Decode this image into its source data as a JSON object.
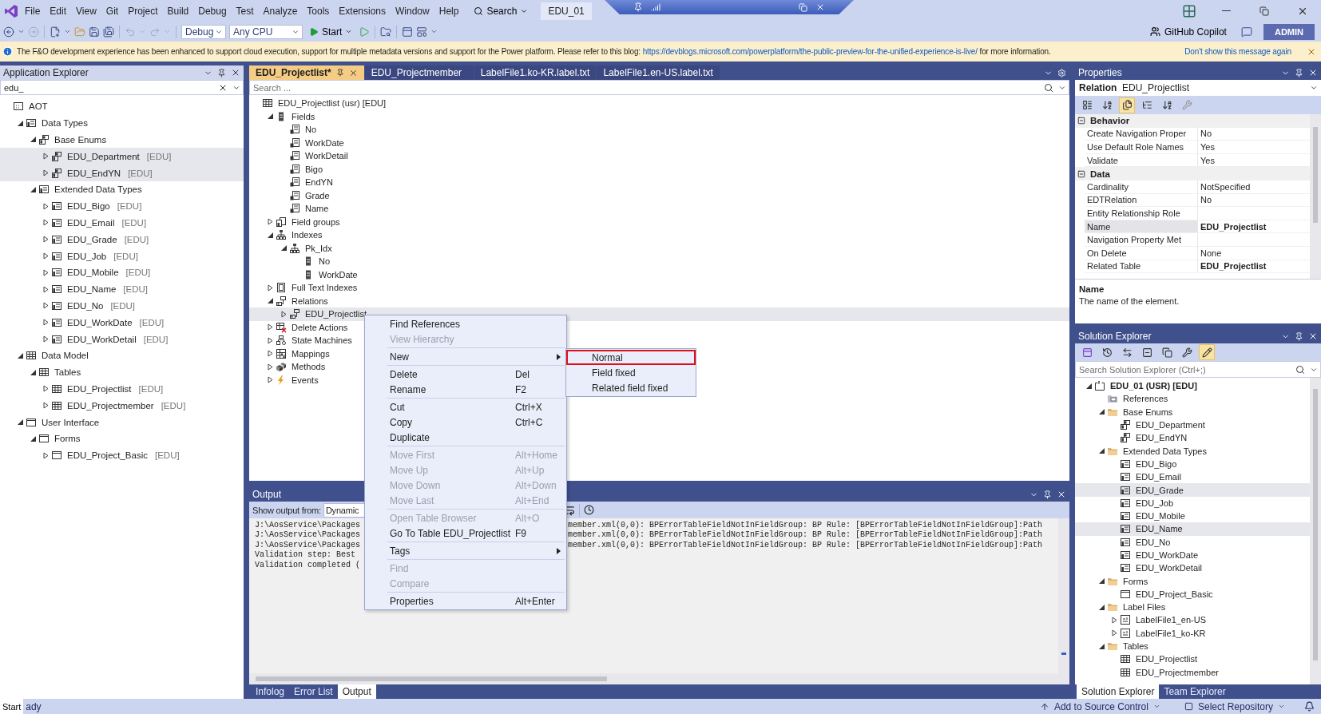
{
  "menu_bar": {
    "items": [
      "File",
      "Edit",
      "View",
      "Git",
      "Project",
      "Build",
      "Debug",
      "Test",
      "Analyze",
      "Tools",
      "Extensions",
      "Window",
      "Help"
    ],
    "search": "Search",
    "solution_name": "EDU_01"
  },
  "toolbar": {
    "configuration": "Debug",
    "platform": "Any CPU",
    "start": "Start",
    "copilot": "GitHub Copilot",
    "account": "ADMIN"
  },
  "info_bar": {
    "text": "The F&O development experience has been enhanced to support cloud execution, support for multiple metadata versions and support for the Power platform. Please refer to this blog:",
    "link": "https://devblogs.microsoft.com/powerplatform/the-public-preview-for-the-unified-experience-is-live/",
    "text_after": "for more information.",
    "dismiss": "Don't show this message again"
  },
  "application_explorer": {
    "title": "Application Explorer",
    "search": "edu_",
    "tree": [
      {
        "label": "AOT",
        "kind": "aot",
        "selected": false,
        "children": [
          {
            "label": "Data Types",
            "kind": "datatypes",
            "selected": false,
            "expanded": true,
            "children": [
              {
                "label": "Base Enums",
                "kind": "enum",
                "selected": false,
                "expanded": true,
                "children": [
                  {
                    "label": "EDU_Department",
                    "tag": "[EDU]",
                    "kind": "enum",
                    "selected": true,
                    "expanded": false
                  },
                  {
                    "label": "EDU_EndYN",
                    "tag": "[EDU]",
                    "kind": "enum",
                    "selected": true,
                    "expanded": false
                  }
                ]
              },
              {
                "label": "Extended Data Types",
                "kind": "edt",
                "selected": false,
                "expanded": true,
                "children": [
                  {
                    "label": "EDU_Bigo",
                    "tag": "[EDU]",
                    "kind": "edt",
                    "selected": false,
                    "expanded": false
                  },
                  {
                    "label": "EDU_Email",
                    "tag": "[EDU]",
                    "kind": "edt",
                    "selected": false,
                    "expanded": false
                  },
                  {
                    "label": "EDU_Grade",
                    "tag": "[EDU]",
                    "kind": "edt",
                    "selected": false,
                    "expanded": false
                  },
                  {
                    "label": "EDU_Job",
                    "tag": "[EDU]",
                    "kind": "edt",
                    "selected": false,
                    "expanded": false
                  },
                  {
                    "label": "EDU_Mobile",
                    "tag": "[EDU]",
                    "kind": "edt",
                    "selected": false,
                    "expanded": false
                  },
                  {
                    "label": "EDU_Name",
                    "tag": "[EDU]",
                    "kind": "edt",
                    "selected": false,
                    "expanded": false
                  },
                  {
                    "label": "EDU_No",
                    "tag": "[EDU]",
                    "kind": "edt",
                    "selected": false,
                    "expanded": false
                  },
                  {
                    "label": "EDU_WorkDate",
                    "tag": "[EDU]",
                    "kind": "edt",
                    "selected": false,
                    "expanded": false
                  },
                  {
                    "label": "EDU_WorkDetail",
                    "tag": "[EDU]",
                    "kind": "edt",
                    "selected": false,
                    "expanded": false
                  }
                ]
              }
            ]
          },
          {
            "label": "Data Model",
            "kind": "table",
            "selected": false,
            "expanded": true,
            "children": [
              {
                "label": "Tables",
                "kind": "table",
                "selected": false,
                "expanded": true,
                "children": [
                  {
                    "label": "EDU_Projectlist",
                    "tag": "[EDU]",
                    "kind": "table",
                    "selected": false,
                    "expanded": false
                  },
                  {
                    "label": "EDU_Projectmember",
                    "tag": "[EDU]",
                    "kind": "table",
                    "selected": false,
                    "expanded": false
                  }
                ]
              }
            ]
          },
          {
            "label": "User Interface",
            "kind": "form",
            "selected": false,
            "expanded": true,
            "children": [
              {
                "label": "Forms",
                "kind": "form",
                "selected": false,
                "expanded": true,
                "children": [
                  {
                    "label": "EDU_Project_Basic",
                    "tag": "[EDU]",
                    "kind": "form",
                    "selected": false,
                    "expanded": false
                  }
                ]
              }
            ]
          }
        ]
      }
    ]
  },
  "editor": {
    "tabs": [
      {
        "label": "EDU_Projectlist*",
        "selected": true
      },
      {
        "label": "EDU_Projectmember",
        "selected": false
      },
      {
        "label": "LabelFile1.ko-KR.label.txt",
        "selected": false
      },
      {
        "label": "LabelFile1.en-US.label.txt",
        "selected": false
      }
    ],
    "search_placeholder": "Search ...",
    "tree": [
      {
        "label": "EDU_Projectlist (usr) [EDU]",
        "kind": "table",
        "selected": false,
        "children": [
          {
            "label": "Fields",
            "kind": "column",
            "selected": false,
            "expanded": true,
            "children": [
              {
                "label": "No",
                "kind": "field",
                "selected": false
              },
              {
                "label": "WorkDate",
                "kind": "field",
                "selected": false
              },
              {
                "label": "WorkDetail",
                "kind": "field",
                "selected": false
              },
              {
                "label": "Bigo",
                "kind": "field",
                "selected": false
              },
              {
                "label": "EndYN",
                "kind": "field",
                "selected": false
              },
              {
                "label": "Grade",
                "kind": "field",
                "selected": false
              },
              {
                "label": "Name",
                "kind": "field",
                "selected": false
              }
            ]
          },
          {
            "label": "Field groups",
            "kind": "fieldgroups",
            "selected": false,
            "expanded": false
          },
          {
            "label": "Indexes",
            "kind": "index",
            "selected": false,
            "expanded": true,
            "children": [
              {
                "label": "Pk_Idx",
                "kind": "index",
                "selected": false,
                "expanded": true,
                "children": [
                  {
                    "label": "No",
                    "kind": "column",
                    "selected": false
                  },
                  {
                    "label": "WorkDate",
                    "kind": "column",
                    "selected": false
                  }
                ]
              }
            ]
          },
          {
            "label": "Full Text Indexes",
            "kind": "fulltext",
            "selected": false,
            "expanded": false
          },
          {
            "label": "Relations",
            "kind": "relation",
            "selected": false,
            "expanded": true,
            "children": [
              {
                "label": "EDU_Projectlist",
                "kind": "relation",
                "selected": true,
                "expanded": false
              }
            ]
          },
          {
            "label": "Delete Actions",
            "kind": "delete",
            "selected": false,
            "expanded": false
          },
          {
            "label": "State Machines",
            "kind": "state",
            "selected": false,
            "expanded": false
          },
          {
            "label": "Mappings",
            "kind": "mapping",
            "selected": false,
            "expanded": false
          },
          {
            "label": "Methods",
            "kind": "methods",
            "selected": false,
            "expanded": false
          },
          {
            "label": "Events",
            "kind": "events",
            "selected": false,
            "expanded": false
          }
        ]
      }
    ]
  },
  "context_menu": {
    "groups": [
      [
        {
          "label": "Find References",
          "disabled": false
        },
        {
          "label": "View Hierarchy",
          "disabled": true
        }
      ],
      [
        {
          "label": "New",
          "disabled": false,
          "submenu": true
        }
      ],
      [
        {
          "label": "Delete",
          "shortcut": "Del",
          "disabled": false
        },
        {
          "label": "Rename",
          "shortcut": "F2",
          "disabled": false
        }
      ],
      [
        {
          "label": "Cut",
          "shortcut": "Ctrl+X",
          "disabled": false
        },
        {
          "label": "Copy",
          "shortcut": "Ctrl+C",
          "disabled": false
        },
        {
          "label": "Duplicate",
          "disabled": false
        }
      ],
      [
        {
          "label": "Move First",
          "shortcut": "Alt+Home",
          "disabled": true
        },
        {
          "label": "Move Up",
          "shortcut": "Alt+Up",
          "disabled": true
        },
        {
          "label": "Move Down",
          "shortcut": "Alt+Down",
          "disabled": true
        },
        {
          "label": "Move Last",
          "shortcut": "Alt+End",
          "disabled": true
        }
      ],
      [
        {
          "label": "Open Table Browser",
          "shortcut": "Alt+O",
          "disabled": true
        },
        {
          "label": "Go To Table EDU_Projectlist",
          "shortcut": "F9",
          "disabled": false
        }
      ],
      [
        {
          "label": "Tags",
          "disabled": false,
          "submenu": true
        }
      ],
      [
        {
          "label": "Find",
          "disabled": true
        },
        {
          "label": "Compare",
          "disabled": true
        }
      ],
      [
        {
          "label": "Properties",
          "shortcut": "Alt+Enter",
          "disabled": false
        }
      ]
    ],
    "submenu": [
      {
        "label": "Normal",
        "selected": true
      },
      {
        "label": "Field fixed",
        "selected": false
      },
      {
        "label": "Related field fixed",
        "selected": false
      }
    ]
  },
  "output": {
    "title": "Output",
    "show_from_label": "Show output from:",
    "source": "Dynamic",
    "lines": [
      {
        "left": "J:\\AosService\\Packages",
        "right": "member.xml(0,0):  BPErrorTableFieldNotInFieldGroup: BP Rule: [BPErrorTableFieldNotInFieldGroup]:Path"
      },
      {
        "left": "J:\\AosService\\Packages",
        "right": "member.xml(0,0):  BPErrorTableFieldNotInFieldGroup: BP Rule: [BPErrorTableFieldNotInFieldGroup]:Path"
      },
      {
        "left": "J:\\AosService\\Packages",
        "right": "member.xml(0,0):  BPErrorTableFieldNotInFieldGroup: BP Rule: [BPErrorTableFieldNotInFieldGroup]:Path"
      },
      {
        "left": "Validation step: Best"
      },
      {
        "left": "Validation completed ("
      }
    ],
    "tabs": [
      {
        "label": "Infolog",
        "selected": false
      },
      {
        "label": "Error List",
        "selected": false
      },
      {
        "label": "Output",
        "selected": true
      }
    ]
  },
  "properties": {
    "title": "Properties",
    "object_type": "Relation",
    "object_name": "EDU_Projectlist",
    "categories": [
      {
        "name": "Behavior",
        "expanded": true,
        "rows": [
          {
            "name": "Create Navigation Proper",
            "value": "No",
            "selected": false
          },
          {
            "name": "Use Default Role Names",
            "value": "Yes",
            "selected": false
          },
          {
            "name": "Validate",
            "value": "Yes",
            "selected": false
          }
        ]
      },
      {
        "name": "Data",
        "expanded": true,
        "rows": [
          {
            "name": "Cardinality",
            "value": "NotSpecified",
            "selected": false
          },
          {
            "name": "EDTRelation",
            "value": "No",
            "selected": false
          },
          {
            "name": "Entity Relationship Role",
            "selected": false
          },
          {
            "name": "Name",
            "value": "EDU_Projectlist",
            "bold": true,
            "selected": true
          },
          {
            "name": "Navigation Property Met",
            "selected": false
          },
          {
            "name": "On Delete",
            "value": "None",
            "selected": false
          },
          {
            "name": "Related Table",
            "value": "EDU_Projectlist",
            "bold": true,
            "selected": false
          }
        ]
      }
    ],
    "description_title": "Name",
    "description": "The name of the element."
  },
  "solution_explorer": {
    "title": "Solution Explorer",
    "search_placeholder": "Search Solution Explorer (Ctrl+;)",
    "tree": [
      {
        "label": "EDU_01 (USR) [EDU]",
        "kind": "project",
        "selected": false,
        "expanded": true,
        "children": [
          {
            "label": "References",
            "kind": "references",
            "selected": false
          },
          {
            "label": "Base Enums",
            "kind": "folder",
            "selected": false,
            "expanded": true,
            "children": [
              {
                "label": "EDU_Department",
                "kind": "enum",
                "selected": false
              },
              {
                "label": "EDU_EndYN",
                "kind": "enum",
                "selected": false
              }
            ]
          },
          {
            "label": "Extended Data Types",
            "kind": "folder",
            "selected": false,
            "expanded": true,
            "children": [
              {
                "label": "EDU_Bigo",
                "kind": "edt",
                "selected": false
              },
              {
                "label": "EDU_Email",
                "kind": "edt",
                "selected": false
              },
              {
                "label": "EDU_Grade",
                "kind": "edt",
                "selected": true
              },
              {
                "label": "EDU_Job",
                "kind": "edt",
                "selected": false
              },
              {
                "label": "EDU_Mobile",
                "kind": "edt",
                "selected": false
              },
              {
                "label": "EDU_Name",
                "kind": "edt",
                "selected": true
              },
              {
                "label": "EDU_No",
                "kind": "edt",
                "selected": false
              },
              {
                "label": "EDU_WorkDate",
                "kind": "edt",
                "selected": false
              },
              {
                "label": "EDU_WorkDetail",
                "kind": "edt",
                "selected": false
              }
            ]
          },
          {
            "label": "Forms",
            "kind": "folder",
            "selected": false,
            "expanded": true,
            "children": [
              {
                "label": "EDU_Project_Basic",
                "kind": "form",
                "selected": false
              }
            ]
          },
          {
            "label": "Label Files",
            "kind": "folder",
            "selected": false,
            "expanded": true,
            "children": [
              {
                "label": "LabelFile1_en-US",
                "kind": "label",
                "selected": false,
                "expanded": false
              },
              {
                "label": "LabelFile1_ko-KR",
                "kind": "label",
                "selected": false,
                "expanded": false
              }
            ]
          },
          {
            "label": "Tables",
            "kind": "folder",
            "selected": false,
            "expanded": true,
            "children": [
              {
                "label": "EDU_Projectlist",
                "kind": "table",
                "selected": false
              },
              {
                "label": "EDU_Projectmember",
                "kind": "table",
                "selected": false
              }
            ]
          }
        ]
      }
    ],
    "tabs": [
      {
        "label": "Solution Explorer",
        "selected": true
      },
      {
        "label": "Team Explorer",
        "selected": false
      }
    ]
  },
  "status_bar": {
    "start": "Start",
    "status": "ady",
    "source_control": "Add to Source Control",
    "repository": "Select Repository"
  }
}
